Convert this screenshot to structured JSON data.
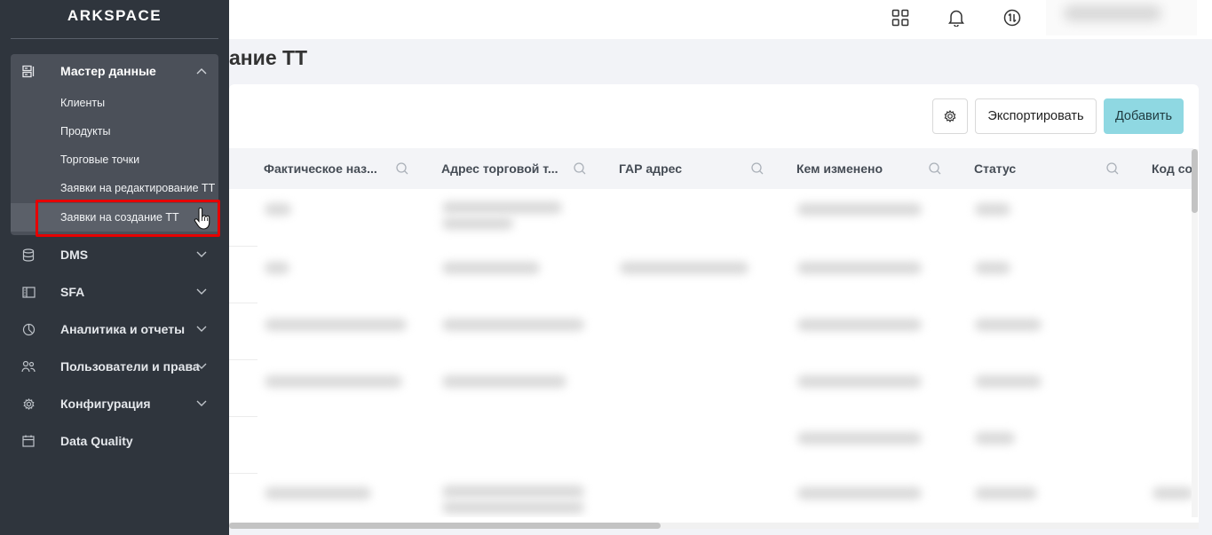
{
  "sidebar": {
    "logo": "ARKSPACE",
    "master_data": {
      "label": "Мастер данные",
      "icon": "master-data-icon",
      "items": [
        {
          "label": "Клиенты"
        },
        {
          "label": "Продукты"
        },
        {
          "label": "Торговые точки"
        },
        {
          "label": "Заявки на редактирование ТТ"
        },
        {
          "label": "Заявки на создание ТТ",
          "selected": true
        }
      ]
    },
    "sections": [
      {
        "label": "DMS",
        "icon": "database-icon",
        "expandable": true
      },
      {
        "label": "SFA",
        "icon": "sfa-panel-icon",
        "expandable": true
      },
      {
        "label": "Аналитика и отчеты",
        "icon": "pie-chart-icon",
        "expandable": true
      },
      {
        "label": "Пользователи и права",
        "icon": "users-icon",
        "expandable": true
      },
      {
        "label": "Конфигурация",
        "icon": "gear-icon",
        "expandable": true
      },
      {
        "label": "Data Quality",
        "icon": "calendar-icon",
        "expandable": false
      }
    ]
  },
  "header": {
    "icons": [
      "apps-grid-icon",
      "bell-icon",
      "sync-icon"
    ]
  },
  "page": {
    "title": "ание ТТ"
  },
  "toolbar": {
    "settings_icon": "gear-icon",
    "export_label": "Экспортировать",
    "add_label": "Добавить"
  },
  "table": {
    "columns": [
      {
        "label": "Фактическое наз..."
      },
      {
        "label": "Адрес торговой т..."
      },
      {
        "label": "ГАР адрес"
      },
      {
        "label": "Кем изменено"
      },
      {
        "label": "Статус"
      },
      {
        "label": "Код со"
      }
    ],
    "row_count_visible": 6,
    "content_blurred": true
  },
  "colors": {
    "sidebar_bg": "#2f353d",
    "submenu_bg": "#4b5059",
    "add_button": "#8fd8e2",
    "highlight": "#e60000"
  }
}
